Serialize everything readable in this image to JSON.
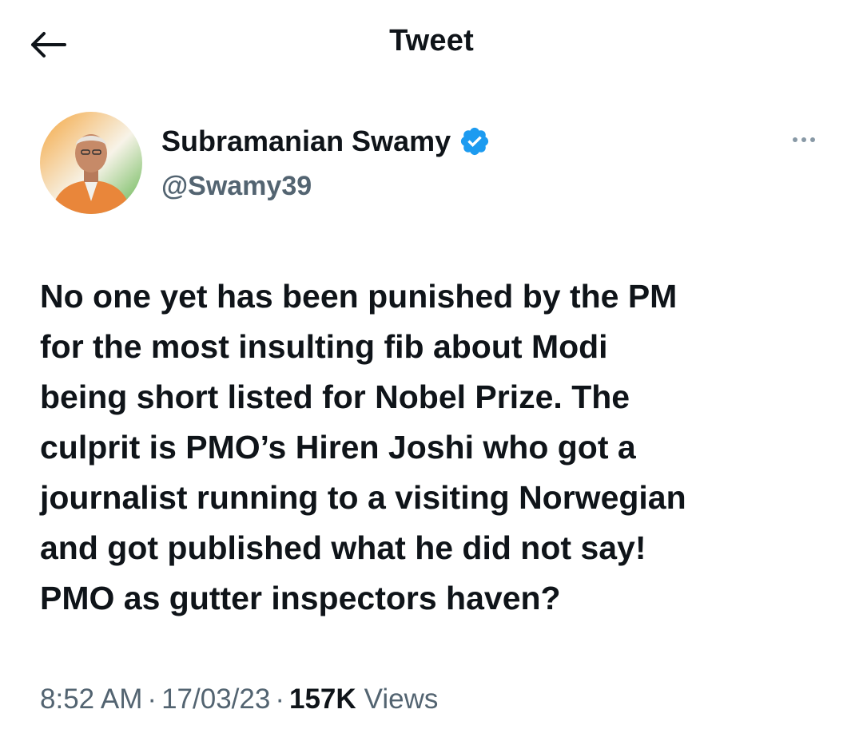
{
  "header": {
    "title": "Tweet",
    "back_icon": "arrow-left-icon"
  },
  "author": {
    "name": "Subramanian Swamy",
    "handle": "@Swamy39",
    "verified_icon": "verified-badge-icon",
    "verified_color": "#1d9bf0",
    "more_icon": "more-horizontal-icon"
  },
  "tweet": {
    "lines": [
      "No one yet has been punished by the PM",
      "for the most insulting fib about Modi",
      "being short listed for Nobel Prize. The",
      "culprit is PMO’s Hiren Joshi who got a",
      "journalist running to a visiting Norwegian",
      "and got published what he did not say!",
      "PMO as gutter inspectors haven?"
    ]
  },
  "meta": {
    "time": "8:52 AM",
    "separator": "·",
    "date": "17/03/23",
    "views_count": "157K",
    "views_label": "Views"
  },
  "colors": {
    "text": "#0f1419",
    "secondary": "#536471",
    "accent": "#1d9bf0"
  }
}
